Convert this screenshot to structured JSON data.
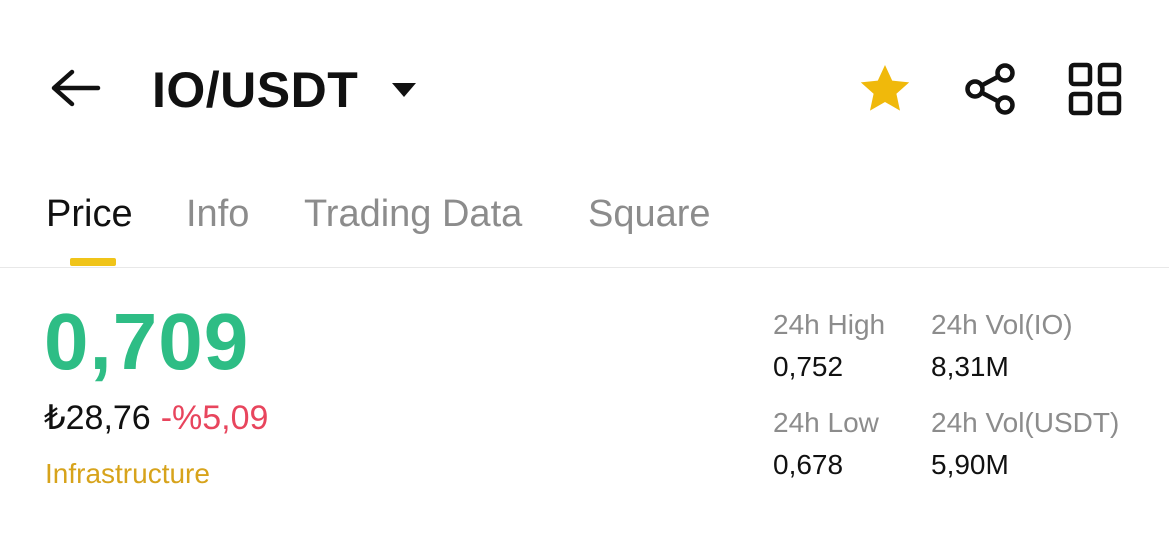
{
  "header": {
    "pair": "IO/USDT",
    "icons": {
      "back": "arrow-left-icon",
      "caret": "caret-down-icon",
      "favorite": "star-icon",
      "share": "share-icon",
      "more": "grid-icon"
    },
    "favorite_color": "#f0b90b"
  },
  "tabs": [
    {
      "label": "Price",
      "active": true
    },
    {
      "label": "Info",
      "active": false
    },
    {
      "label": "Trading Data",
      "active": false
    },
    {
      "label": "Square",
      "active": false
    }
  ],
  "price": {
    "last": "0,709",
    "fiat": "₺28,76",
    "change": "-%5,09",
    "category": "Infrastructure",
    "colors": {
      "up": "#2ebd85",
      "down": "#e8455d",
      "category": "#d7a31b",
      "tab_indicator": "#f0c419"
    }
  },
  "stats": {
    "high_label": "24h High",
    "high_value": "0,752",
    "low_label": "24h Low",
    "low_value": "0,678",
    "vol_base_label": "24h Vol(IO)",
    "vol_base_value": "8,31M",
    "vol_quote_label": "24h Vol(USDT)",
    "vol_quote_value": "5,90M"
  }
}
